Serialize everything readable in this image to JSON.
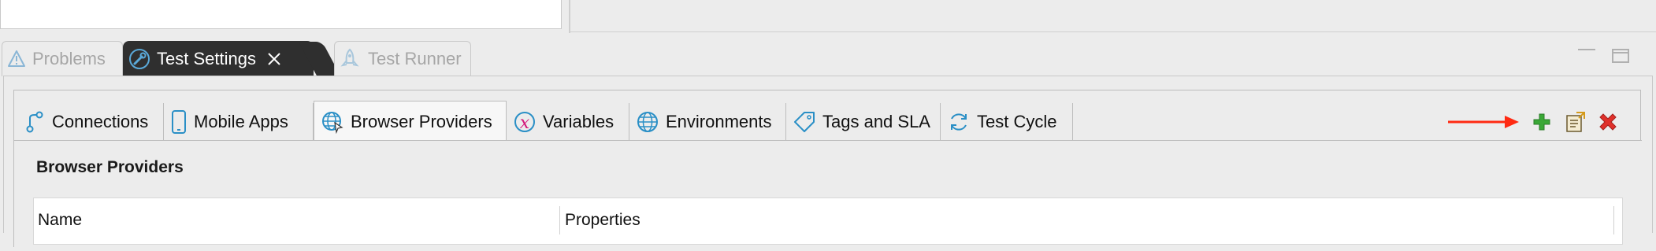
{
  "view_tabs": [
    {
      "label": "Problems",
      "icon": "warning-icon",
      "active": false
    },
    {
      "label": "Test Settings",
      "icon": "settings-wrench-icon",
      "active": true
    },
    {
      "label": "Test Runner",
      "icon": "rocket-icon",
      "active": false
    }
  ],
  "editor_tabs": [
    {
      "label": "Connections",
      "icon": "connections-icon"
    },
    {
      "label": "Mobile Apps",
      "icon": "mobile-icon"
    },
    {
      "label": "Browser Providers",
      "icon": "globe-cursor-icon",
      "active": true
    },
    {
      "label": "Variables",
      "icon": "variable-x-icon"
    },
    {
      "label": "Environments",
      "icon": "globe-icon"
    },
    {
      "label": "Tags and SLA",
      "icon": "tag-icon"
    },
    {
      "label": "Test Cycle",
      "icon": "cycle-icon"
    }
  ],
  "toolbar": {
    "add_icon": "green-plus-icon",
    "edit_icon": "edit-document-icon",
    "delete_icon": "red-x-icon",
    "annotation_color": "#ff2a12"
  },
  "section": {
    "title": "Browser Providers"
  },
  "table": {
    "columns": [
      "Name",
      "Properties"
    ]
  },
  "colors": {
    "active_view_tab": "#2f2f2f",
    "icon_blue": "#2a8fc6",
    "add_green": "#3aa836",
    "delete_red": "#e0302a"
  }
}
